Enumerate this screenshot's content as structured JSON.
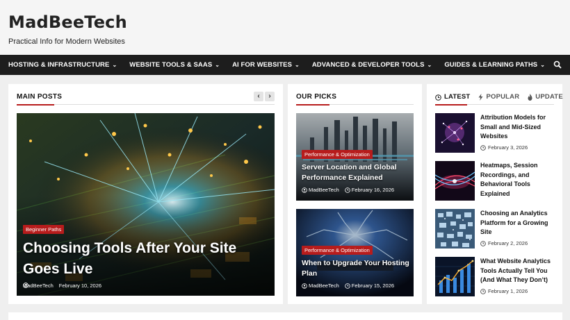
{
  "site": {
    "title": "MadBeeTech",
    "tagline": "Practical Info for Modern Websites"
  },
  "nav": {
    "items": [
      {
        "label": "HOSTING & INFRASTRUCTURE"
      },
      {
        "label": "WEBSITE TOOLS & SAAS"
      },
      {
        "label": "AI FOR WEBSITES"
      },
      {
        "label": "ADVANCED & DEVELOPER TOOLS"
      },
      {
        "label": "GUIDES & LEARNING PATHS"
      }
    ],
    "search_icon": "search-icon"
  },
  "main_posts": {
    "heading": "MAIN POSTS",
    "prev_label": "‹",
    "next_label": "›",
    "feature": {
      "category": "Beginner Paths",
      "title": "Choosing Tools After Your Site Goes Live",
      "author": "MadBeeTech",
      "date": "February 10, 2026"
    }
  },
  "our_picks": {
    "heading": "OUR PICKS",
    "items": [
      {
        "category": "Performance & Optimization",
        "title": "Server Location and Global Performance Explained",
        "author": "MadBeeTech",
        "date": "February 16, 2026"
      },
      {
        "category": "Performance & Optimization",
        "title": "When to Upgrade Your Hosting Plan",
        "author": "MadBeeTech",
        "date": "February 15, 2026"
      }
    ]
  },
  "sidebar": {
    "tabs": [
      {
        "label": "LATEST",
        "icon": "clock-icon"
      },
      {
        "label": "POPULAR",
        "icon": "bolt-icon"
      },
      {
        "label": "UPDATE",
        "icon": "fire-icon"
      }
    ],
    "items": [
      {
        "title": "Attribution Models for Small and Mid-Sized Websites",
        "date": "February 3, 2026"
      },
      {
        "title": "Heatmaps, Session Recordings, and Behavioral Tools Explained",
        "date": "February 2, 2026"
      },
      {
        "title": "Choosing an Analytics Platform for a Growing Site",
        "date": "February 2, 2026"
      },
      {
        "title": "What Website Analytics Tools Actually Tell You (And What They Don’t)",
        "date": "February 1, 2026"
      }
    ]
  },
  "colors": {
    "accent": "#b71c1c",
    "nav_bg": "#1d1d1d",
    "page_bg": "#efefef"
  }
}
